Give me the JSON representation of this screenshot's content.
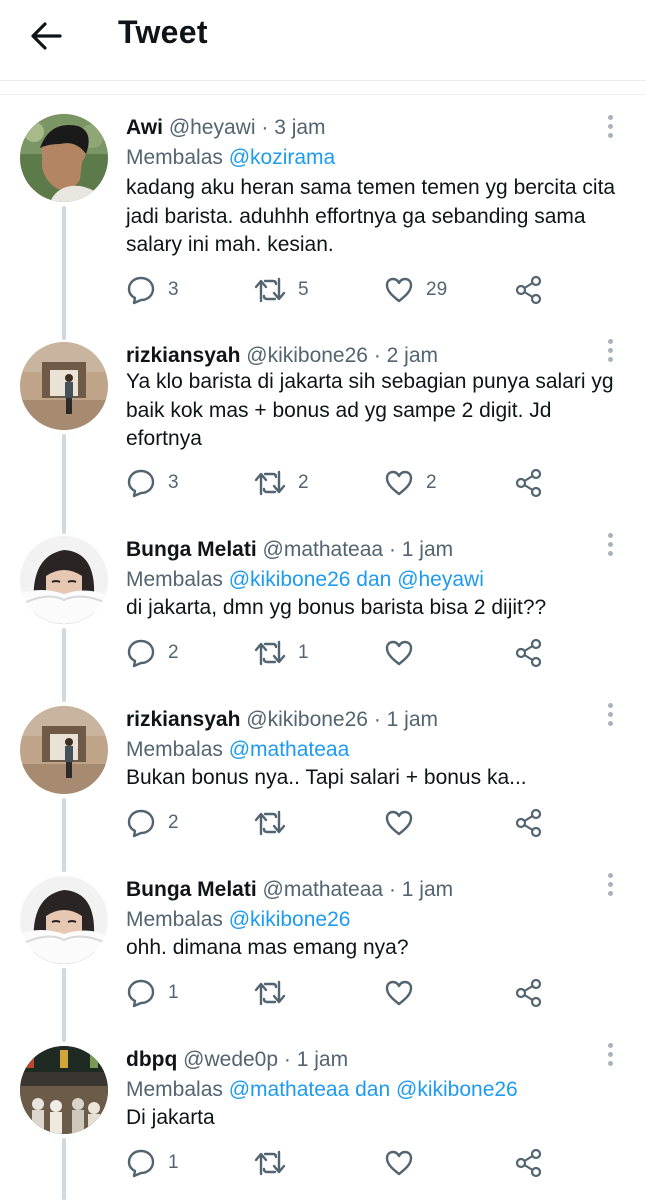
{
  "header": {
    "title": "Tweet"
  },
  "tweets": [
    {
      "name": "Awi",
      "handle": "@heyawi",
      "sep": "·",
      "time": "3 jam",
      "reply_prefix": "Membalas",
      "reply_to": "@kozirama",
      "reply_conj": "",
      "reply_to2": "",
      "lines": [
        "kadang aku heran sama temen temen yg bercita cita",
        "jadi barista. aduhhh effortnya ga sebanding sama",
        "salary ini mah. kesian."
      ],
      "replies": "3",
      "retweets": "5",
      "likes": "29"
    },
    {
      "name": "rizkiansyah",
      "handle": "@kikibone26",
      "sep": "·",
      "time": "2 jam",
      "reply_prefix": "",
      "reply_to": "",
      "reply_conj": "",
      "reply_to2": "",
      "lines": [
        "Ya klo barista di jakarta sih sebagian punya salari yg",
        "baik kok mas + bonus ad yg sampe 2 digit. Jd",
        "efortnya"
      ],
      "replies": "3",
      "retweets": "2",
      "likes": "2"
    },
    {
      "name": "Bunga Melati",
      "handle": "@mathateaa",
      "sep": "·",
      "time": "1 jam",
      "reply_prefix": "Membalas",
      "reply_to": "@kikibone26",
      "reply_conj": "dan",
      "reply_to2": "@heyawi",
      "lines": [
        "di jakarta, dmn yg bonus barista bisa 2 dijit??"
      ],
      "replies": "2",
      "retweets": "1",
      "likes": ""
    },
    {
      "name": "rizkiansyah",
      "handle": "@kikibone26",
      "sep": "·",
      "time": "1 jam",
      "reply_prefix": "Membalas",
      "reply_to": "@mathateaa",
      "reply_conj": "",
      "reply_to2": "",
      "lines": [
        "Bukan bonus nya.. Tapi salari + bonus ka..."
      ],
      "replies": "2",
      "retweets": "",
      "likes": ""
    },
    {
      "name": "Bunga Melati",
      "handle": "@mathateaa",
      "sep": "·",
      "time": "1 jam",
      "reply_prefix": "Membalas",
      "reply_to": "@kikibone26",
      "reply_conj": "",
      "reply_to2": "",
      "lines": [
        "ohh. dimana mas emang nya?"
      ],
      "replies": "1",
      "retweets": "",
      "likes": ""
    },
    {
      "name": "dbpq",
      "handle": "@wede0p",
      "sep": "·",
      "time": "1 jam",
      "reply_prefix": "Membalas",
      "reply_to": "@mathateaa",
      "reply_conj": "dan",
      "reply_to2": "@kikibone26",
      "lines": [
        "Di jakarta"
      ],
      "replies": "1",
      "retweets": "",
      "likes": ""
    }
  ]
}
